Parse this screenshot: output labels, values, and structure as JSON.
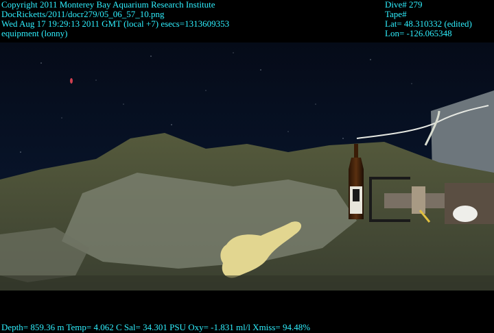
{
  "overlay": {
    "top_left": [
      "Copyright 2011 Monterey Bay Aquarium Research Institute",
      "DocRicketts/2011/docr279/05_06_57_10.png",
      "Wed Aug 17 19:29:13 2011 GMT (local +7)  esecs=1313609353",
      "equipment (lonny)"
    ],
    "top_right": [
      "Dive# 279",
      "Tape#",
      "Lat= 48.310332 (edited)",
      "Lon= -126.065348"
    ],
    "bottom": "Depth= 859.36 m  Temp= 4.062 C  Sal= 34.301 PSU  Oxy= -1.831 ml/l  Xmiss= 94.48%"
  },
  "colors": {
    "overlay_text": "#2ff0ff",
    "water": "#06101e",
    "rock": "#5e6448",
    "sediment": "#8a8e7a"
  }
}
